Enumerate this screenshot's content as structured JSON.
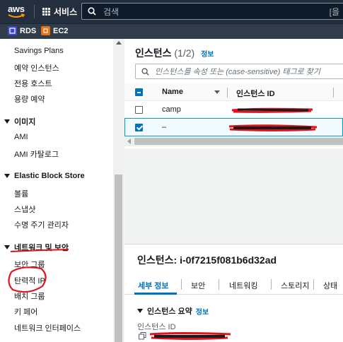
{
  "topbar": {
    "logo_text": "aws",
    "services_label": "서비스",
    "search_placeholder": "검색",
    "search_right_hint": "[을"
  },
  "favorites": [
    {
      "label": "RDS",
      "icon": "rds-icon",
      "color": "#3b48cc"
    },
    {
      "label": "EC2",
      "icon": "ec2-icon",
      "color": "#ec7211"
    }
  ],
  "sidebar": {
    "items_top": [
      "Savings Plans",
      "예약 인스턴스",
      "전용 호스트",
      "용량 예약"
    ],
    "section_images": {
      "title": "이미지",
      "items": [
        "AMI",
        "AMI 카탈로그"
      ]
    },
    "section_ebs": {
      "title": "Elastic Block Store",
      "items": [
        "볼륨",
        "스냅샷",
        "수명 주기 관리자"
      ]
    },
    "section_network": {
      "title": "네트워크 및 보안",
      "items": [
        "보안 그룹",
        "탄력적 IP",
        "배치 그룹",
        "키 페어",
        "네트워크 인터페이스"
      ]
    }
  },
  "instances_panel": {
    "title": "인스턴스",
    "count": "(1/2)",
    "info_link": "정보",
    "search_placeholder": "인스턴스를 속성 또는 (case-sensitive) 태그로 찾기",
    "columns": [
      "Name",
      "인스턴스 ID"
    ],
    "rows": [
      {
        "name": "camp",
        "selected": false
      },
      {
        "name": "–",
        "selected": true
      }
    ]
  },
  "detail_panel": {
    "title": "인스턴스: i-0f7215f081b6d32ad",
    "tabs": [
      "세부 정보",
      "보안",
      "네트워킹",
      "스토리지",
      "상태"
    ],
    "active_tab": "세부 정보",
    "summary_title": "인스턴스 요약",
    "summary_info": "정보",
    "field_label": "인스턴스 ID"
  },
  "colors": {
    "topbar": "#232f3e",
    "link": "#0073bb",
    "annotation_red": "#e0141e"
  }
}
